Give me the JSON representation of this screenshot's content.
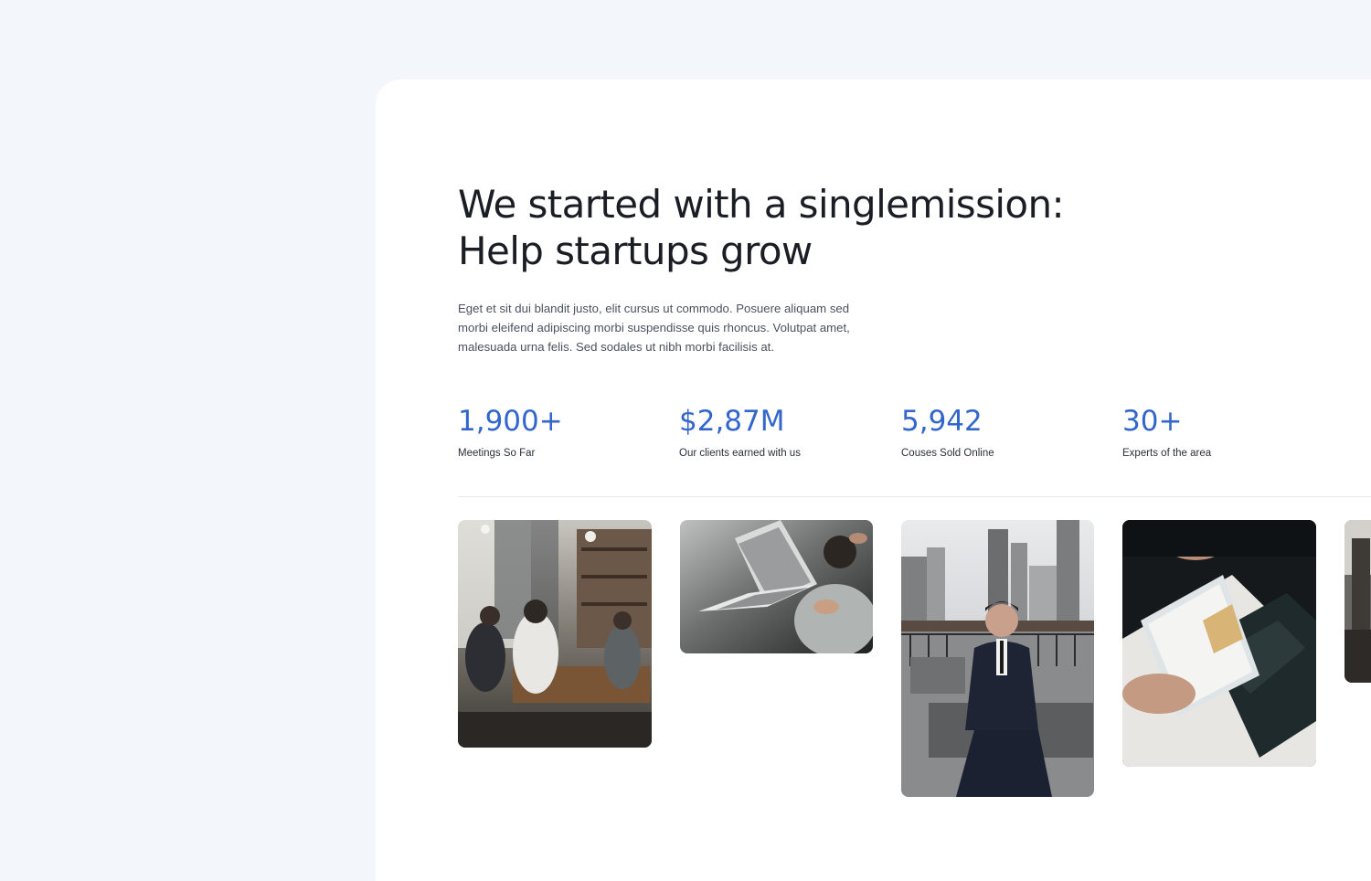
{
  "headline": {
    "line1": "We started with a singlemission:",
    "line2": "Help startups grow"
  },
  "intro": "Eget et sit dui blandit justo, elit cursus ut commodo. Posuere aliquam sed morbi eleifend adipiscing morbi suspendisse quis rhoncus. Volutpat amet, malesuada urna felis. Sed sodales ut nibh morbi facilisis at.",
  "stats": [
    {
      "value": "1,900+",
      "label": "Meetings So Far"
    },
    {
      "value": "$2,87M",
      "label": "Our clients earned with us"
    },
    {
      "value": "5,942",
      "label": "Couses Sold Online"
    },
    {
      "value": "30+",
      "label": "Experts of the area"
    }
  ],
  "photos": [
    {
      "name": "team-meeting-photo"
    },
    {
      "name": "laptop-typing-photo"
    },
    {
      "name": "businessman-rooftop-photo"
    },
    {
      "name": "phone-payment-photo"
    },
    {
      "name": "cropped-photo"
    }
  ],
  "colors": {
    "page_background": "#f3f6fa",
    "panel_background": "#ffffff",
    "accent": "#3366cc",
    "heading_text": "#1a1d24",
    "body_text": "#4b5160"
  }
}
